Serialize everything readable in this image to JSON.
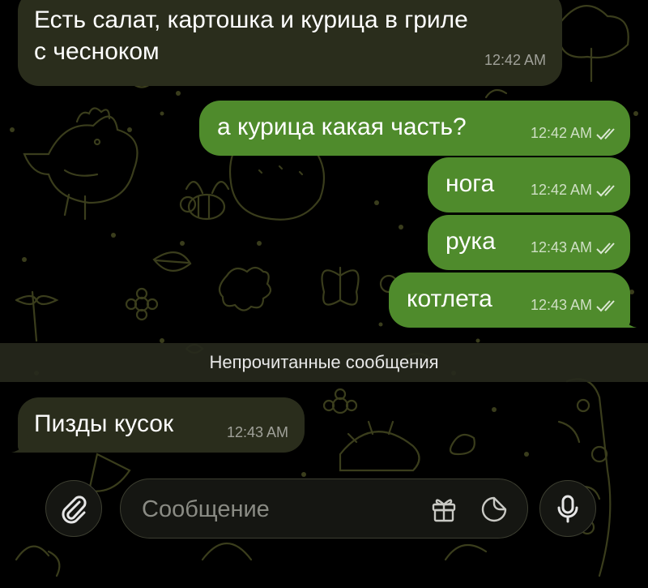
{
  "colors": {
    "incoming_bubble": "#2a2d1c",
    "outgoing_bubble": "#4f8b2c",
    "wallpaper_doodle": "#3a3d1c",
    "background": "#000000"
  },
  "messages": [
    {
      "direction": "incoming",
      "lines": [
        "Есть салат, картошка и курица в гриле",
        "с чесноком"
      ],
      "time": "12:42 AM"
    },
    {
      "direction": "outgoing",
      "text": "а курица какая часть?",
      "time": "12:42 AM",
      "status": "read"
    },
    {
      "direction": "outgoing",
      "text": "нога",
      "time": "12:42 AM",
      "status": "read"
    },
    {
      "direction": "outgoing",
      "text": "рука",
      "time": "12:43 AM",
      "status": "read"
    },
    {
      "direction": "outgoing",
      "text": "котлета",
      "time": "12:43 AM",
      "status": "read"
    },
    {
      "direction": "incoming",
      "text": "Пизды кусок",
      "time": "12:43 AM"
    }
  ],
  "unread_divider": "Непрочитанные сообщения",
  "composer": {
    "placeholder": "Сообщение",
    "attach_icon": "paperclip-icon",
    "gift_icon": "gift-icon",
    "sticker_icon": "sticker-icon",
    "mic_icon": "microphone-icon"
  }
}
